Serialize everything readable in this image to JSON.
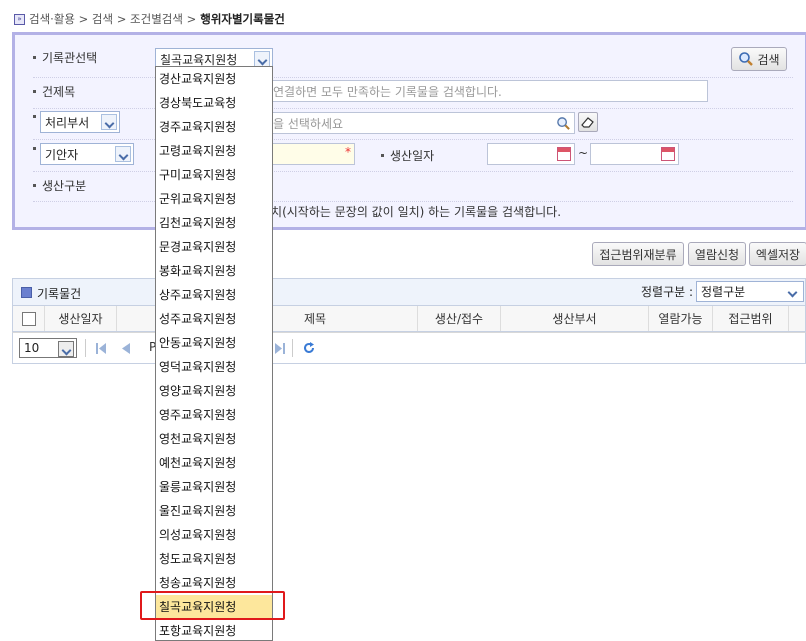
{
  "breadcrumb": {
    "path": "검색·활용 > 검색 > 조건별검색 >",
    "current": "행위자별기록물건"
  },
  "search": {
    "institution_label": "기록관선택",
    "institution_value": "칠곡교육지원청",
    "search_button": "검색",
    "title_label": "건제목",
    "title_placeholder": "연결하면 모두 만족하는 기록물을 검색합니다.",
    "dept_select": "처리부서",
    "dept_placeholder": "을 선택하세요",
    "drafter_select": "기안자",
    "required_mark": "*",
    "date_label": "생산일자",
    "date_sep": "~",
    "type_label": "생산구분",
    "hint_text": "일치(시작하는 문장의 값이 일치) 하는 기록물을 검색합니다."
  },
  "actions": {
    "access_reclass": "접근범위재분류",
    "view_request": "열람신청",
    "excel_save": "엑셀저장"
  },
  "grid": {
    "title": "기록물건",
    "sort_label": "정렬구분 :",
    "sort_value": "정렬구분",
    "columns": [
      "생산일자",
      "제목",
      "생산/접수",
      "생산부서",
      "열람가능",
      "접근범위"
    ],
    "page_size": "10",
    "page_letter": "P"
  },
  "dropdown": {
    "items": [
      "경산교육지원청",
      "경상북도교육청",
      "경주교육지원청",
      "고령교육지원청",
      "구미교육지원청",
      "군위교육지원청",
      "김천교육지원청",
      "문경교육지원청",
      "봉화교육지원청",
      "상주교육지원청",
      "성주교육지원청",
      "안동교육지원청",
      "영덕교육지원청",
      "영양교육지원청",
      "영주교육지원청",
      "영천교육지원청",
      "예천교육지원청",
      "울릉교육지원청",
      "울진교육지원청",
      "의성교육지원청",
      "청도교육지원청",
      "청송교육지원청",
      "칠곡교육지원청",
      "포항교육지원청"
    ],
    "selected_index": 22
  },
  "colors": {
    "panel_border": "#b3b1e6",
    "panel_bg": "#f3f3ff",
    "selected_bg": "#fde79c",
    "highlight": "#e0191b"
  }
}
